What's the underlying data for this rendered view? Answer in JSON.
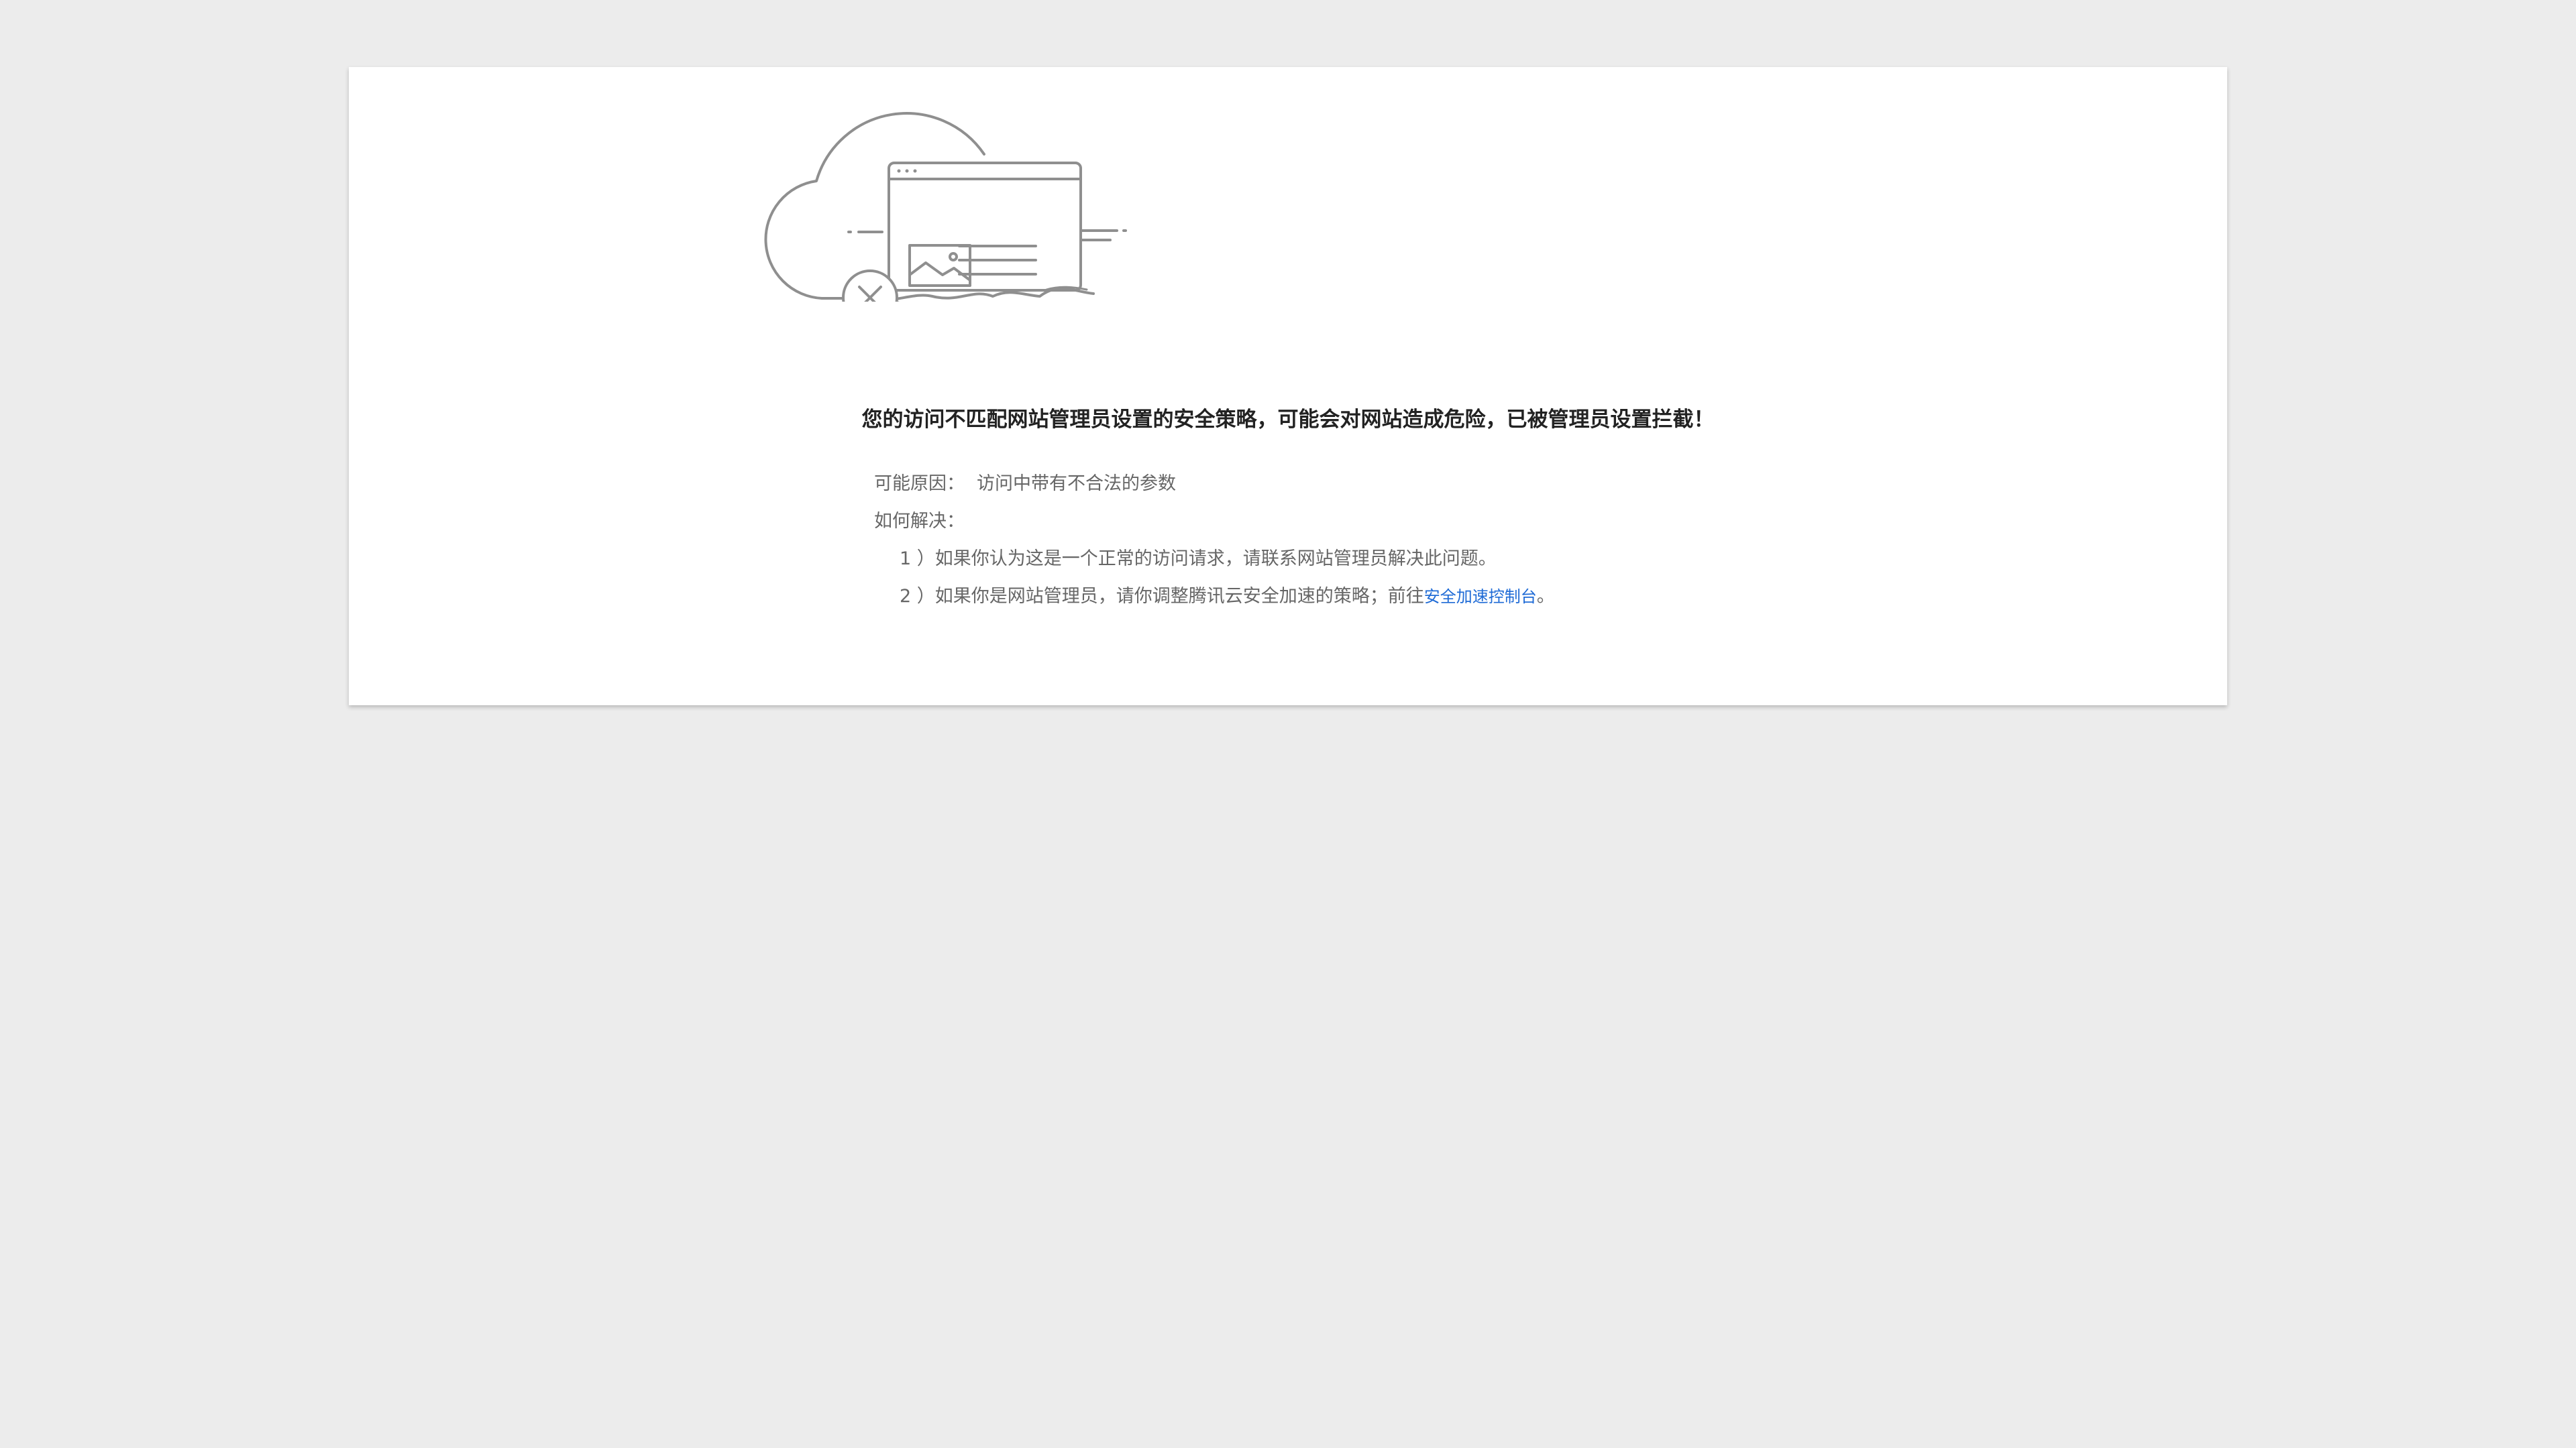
{
  "message": {
    "headline": "您的访问不匹配网站管理员设置的安全策略，可能会对网站造成危险，已被管理员设置拦截！",
    "reason_label": "可能原因：",
    "reason_value": "访问中带有不合法的参数",
    "solution_label": "如何解决：",
    "steps": [
      {
        "prefix": "1 ）",
        "text": "如果你认为这是一个正常的访问请求，请联系网站管理员解决此问题。"
      },
      {
        "prefix": "2 ）",
        "text": "如果你是网站管理员，请你调整腾讯云安全加速的策略；前往",
        "link_text": "安全加速控制台",
        "suffix": "。"
      }
    ]
  },
  "colors": {
    "page_background": "#ececec",
    "card_background": "#ffffff",
    "headline": "#222222",
    "body_text": "#666666",
    "link": "#1f6bd6",
    "illustration_stroke": "#8f8f8f"
  },
  "icons": [
    "cloud-icon",
    "browser-window-icon",
    "image-placeholder-icon",
    "error-x-icon"
  ]
}
